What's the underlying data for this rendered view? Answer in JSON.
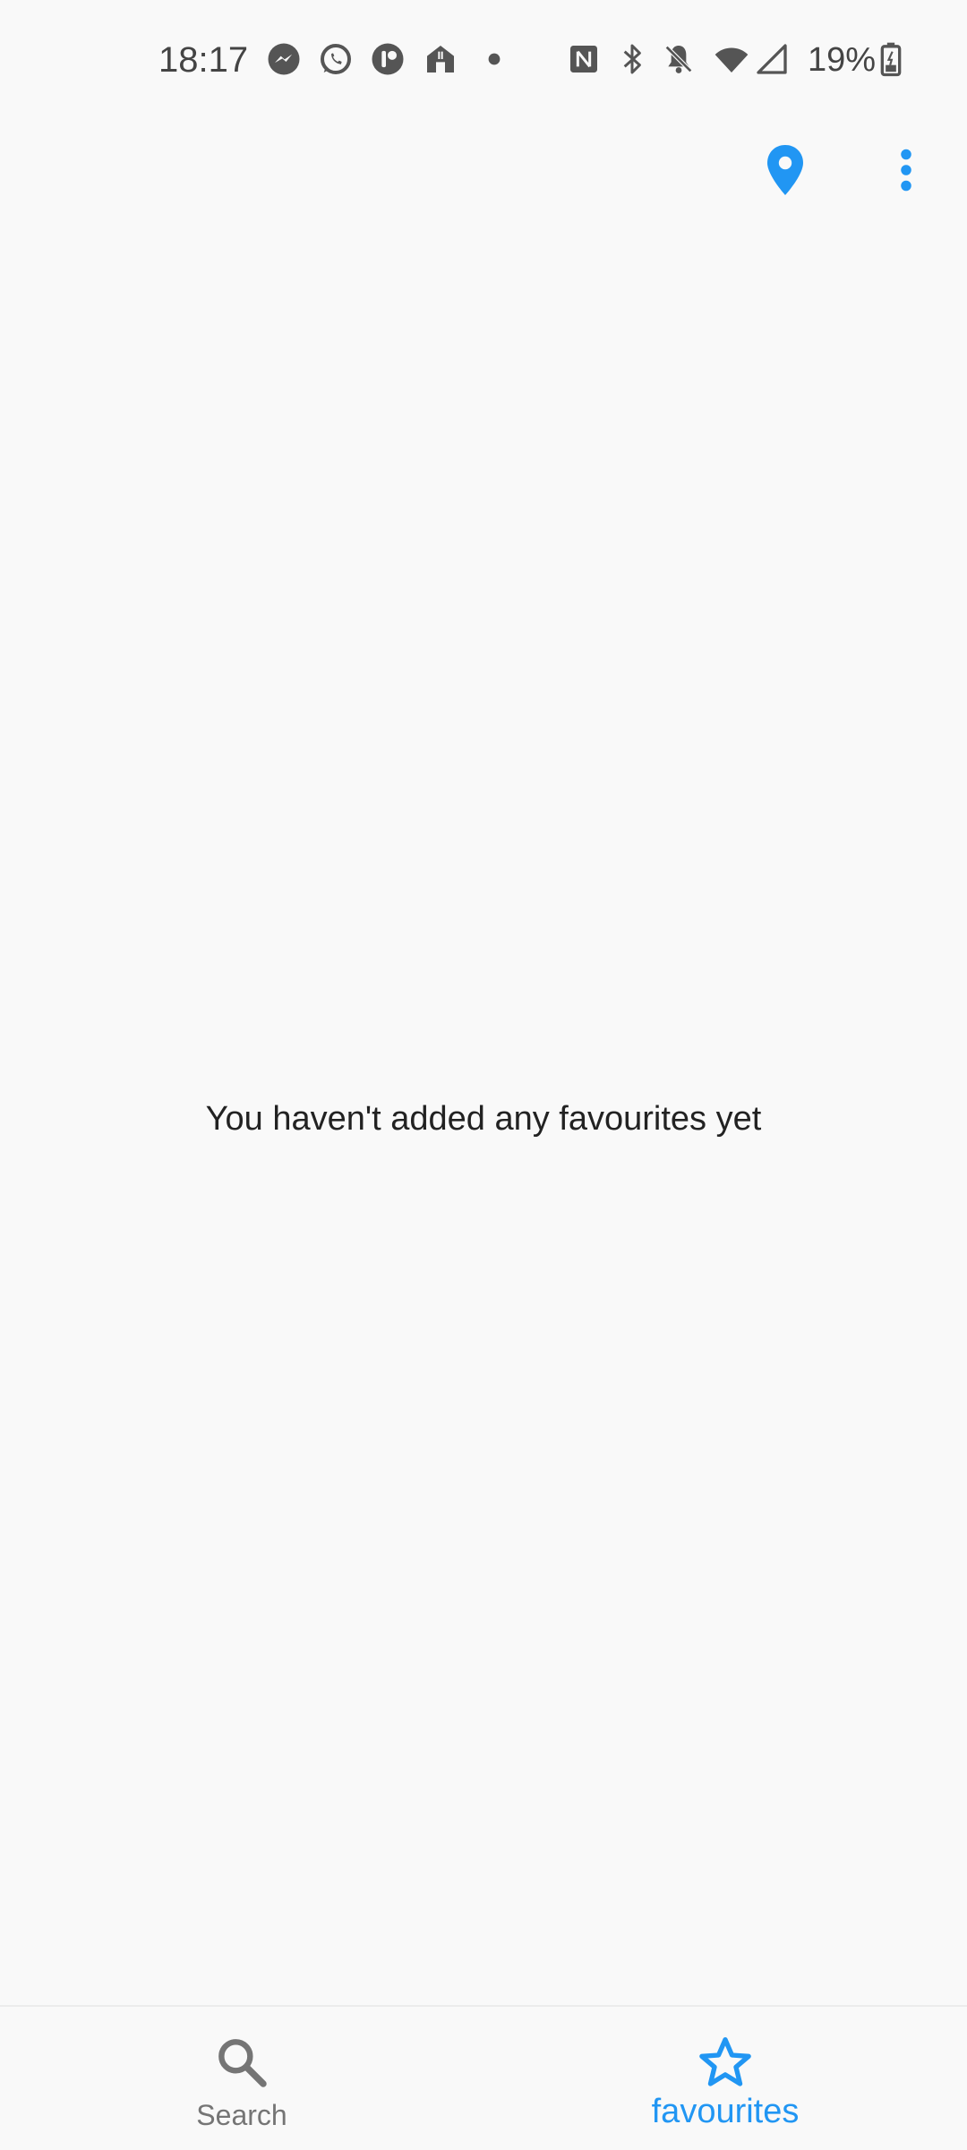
{
  "status_bar": {
    "time": "18:17",
    "battery_percent": "19%",
    "icons": [
      "messenger-icon",
      "whatsapp-icon",
      "app-icon",
      "food-delivery-icon",
      "dot-icon",
      "nfc-icon",
      "bluetooth-icon",
      "bell-muted-icon",
      "wifi-icon",
      "cell-signal-icon",
      "battery-icon"
    ]
  },
  "app_bar": {
    "actions": [
      "location-icon",
      "more-vert-icon"
    ]
  },
  "favourites": {
    "empty_message": "You haven't added any favourites yet"
  },
  "bottom_nav": {
    "items": [
      {
        "label": "Search",
        "icon": "search-icon",
        "active": false
      },
      {
        "label": "favourites",
        "icon": "star-icon",
        "active": true
      }
    ]
  },
  "colors": {
    "accent": "#2196f3",
    "background": "#f9f9f9",
    "inactive": "#757575",
    "status_icons": "#555555"
  }
}
